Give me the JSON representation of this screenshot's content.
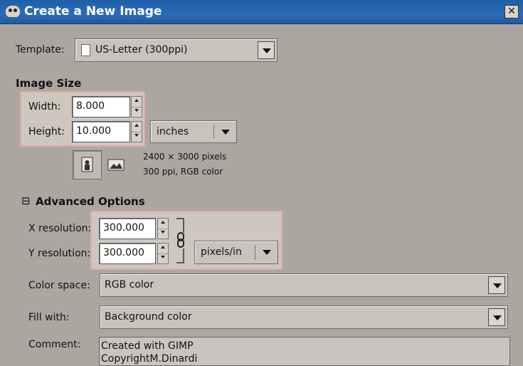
{
  "window": {
    "title": "Create a New Image"
  },
  "template": {
    "label": "Template:",
    "value": "US-Letter (300ppi)"
  },
  "image_size": {
    "heading": "Image Size",
    "width_label": "Width:",
    "width_value": "8.000",
    "height_label": "Height:",
    "height_value": "10.000",
    "unit": "inches",
    "info_pixels": "2400 × 3000 pixels",
    "info_details": "300 ppi, RGB color"
  },
  "advanced": {
    "heading": "Advanced Options",
    "expander": "⊟",
    "x_res_label": "X resolution:",
    "x_res_value": "300.000",
    "y_res_label": "Y resolution:",
    "y_res_value": "300.000",
    "res_unit": "pixels/in",
    "color_space_label": "Color space:",
    "color_space_value": "RGB color",
    "fill_label": "Fill with:",
    "fill_value": "Background color",
    "comment_label": "Comment:",
    "comment_line1": "Created with GIMP",
    "comment_line2": "CopyrightM.Dinardi"
  },
  "icons": {
    "app": "gimp-icon",
    "close": "close-icon",
    "portrait": "portrait-icon",
    "landscape": "landscape-icon",
    "chain": "chain-link-icon"
  },
  "colors": {
    "titlebar": "#2c6bb6",
    "dialog_bg": "#aba7a0",
    "highlight_border": "#e2aaa8"
  }
}
